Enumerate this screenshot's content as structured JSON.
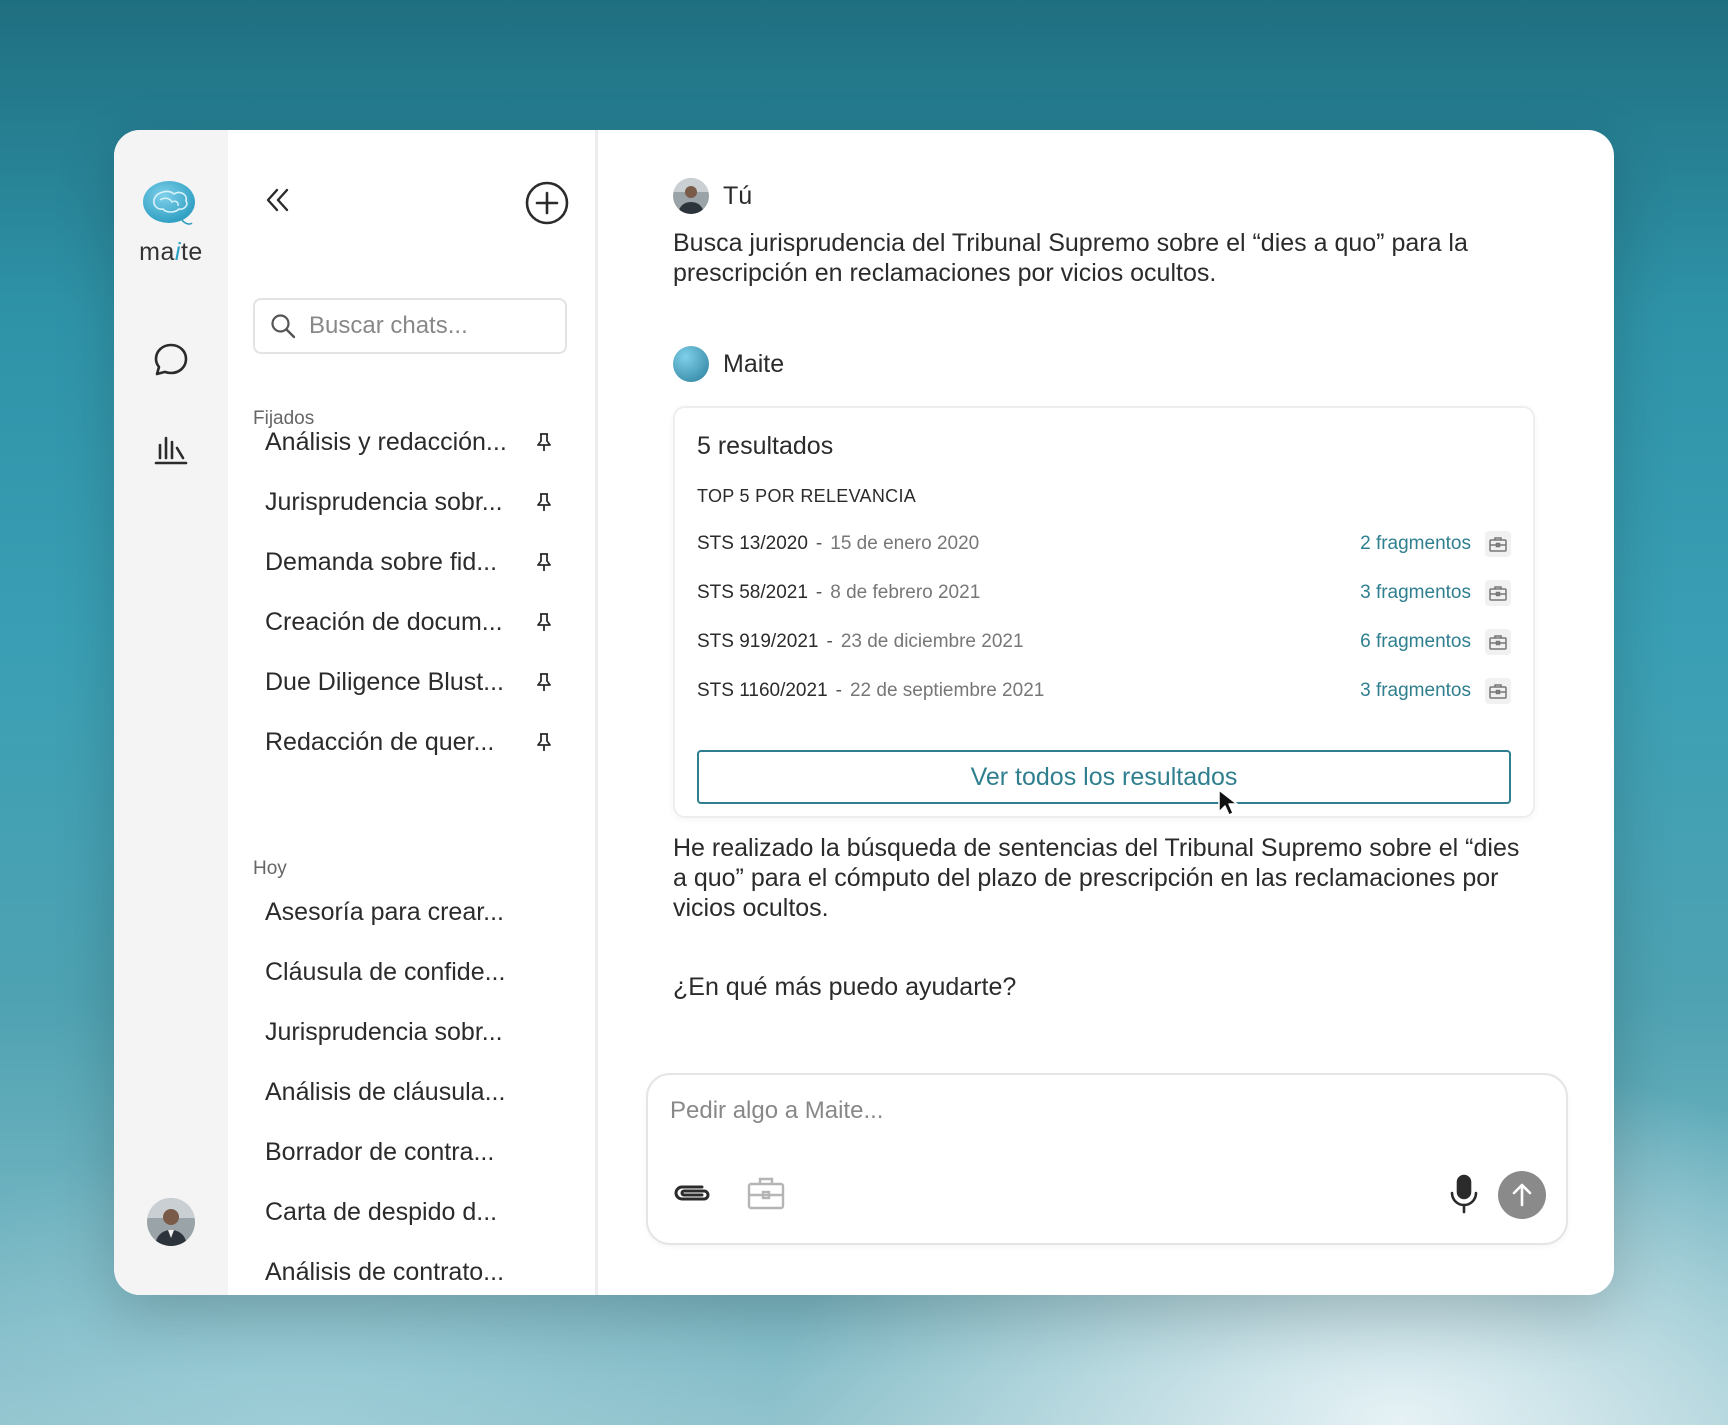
{
  "app": {
    "name": "maite",
    "name_prefix": "ma",
    "name_mid": "i",
    "name_suffix": "te"
  },
  "sidebar": {
    "search_placeholder": "Buscar chats...",
    "pinned_label": "Fijados",
    "pinned": [
      "Análisis y redacción...",
      "Jurisprudencia sobr...",
      "Demanda sobre fid...",
      "Creación de docum...",
      "Due Diligence Blust...",
      "Redacción de quer..."
    ],
    "today_label": "Hoy",
    "today": [
      "Asesoría para crear...",
      "Cláusula de confide...",
      "Jurisprudencia sobr...",
      "Análisis de cláusula...",
      "Borrador de contra...",
      "Carta de despido d...",
      "Análisis de contrato..."
    ]
  },
  "chat": {
    "user_name": "Tú",
    "user_message": [
      "Busca jurisprudencia del Tribunal Supremo sobre el “dies a quo” para la",
      "prescripción en reclamaciones por vicios ocultos."
    ],
    "assistant_name": "Maite",
    "results": {
      "title": "5 resultados",
      "subtitle": "TOP 5 POR RELEVANCIA",
      "items": [
        {
          "ref": "STS 13/2020",
          "sep": "-",
          "date": "15 de enero 2020",
          "fragments": "2 fragmentos"
        },
        {
          "ref": "STS 58/2021",
          "sep": "-",
          "date": "8 de febrero 2021",
          "fragments": "3 fragmentos"
        },
        {
          "ref": "STS 919/2021",
          "sep": "-",
          "date": "23 de diciembre 2021",
          "fragments": "6 fragmentos"
        },
        {
          "ref": "STS 1160/2021",
          "sep": "-",
          "date": "22 de septiembre 2021",
          "fragments": "3 fragmentos"
        }
      ],
      "view_all": "Ver todos los resultados"
    },
    "assistant_message": [
      "He realizado la búsqueda de sentencias del Tribunal Supremo sobre el “dies",
      "a quo” para el cómputo del plazo de prescripción en las reclamaciones por",
      "vicios ocultos."
    ],
    "assistant_followup": "¿En qué más puedo ayudarte?"
  },
  "composer": {
    "placeholder": "Pedir algo a Maite..."
  },
  "colors": {
    "accent": "#2f7f8f",
    "logo": "#2aa0c4",
    "rail_bg": "#f4f4f4"
  },
  "icons": [
    "brain-logo-icon",
    "chat-bubble-icon",
    "stats-icon",
    "collapse-icon",
    "plus-circle-icon",
    "search-icon",
    "pin-icon",
    "briefcase-icon",
    "paperclip-icon",
    "microphone-icon",
    "arrow-up-icon",
    "cursor-icon"
  ]
}
